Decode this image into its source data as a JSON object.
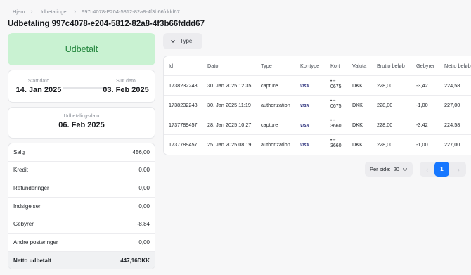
{
  "breadcrumb": {
    "items": [
      "Hjem",
      "Udbetalinger",
      "997c4078-E204-5812-82a8-4f3b66fddd67"
    ]
  },
  "page_title": "Udbetaling 997c4078-e204-5812-82a8-4f3b66fddd67",
  "status": {
    "label": "Udbetalt",
    "color": "#24873e",
    "background": "#c9f2d2"
  },
  "dates": {
    "start_label": "Start dato",
    "start_value": "14. Jan 2025",
    "end_label": "Slut dato",
    "end_value": "03. Feb 2025"
  },
  "payout_date": {
    "label": "Udbetalingsdato",
    "value": "06. Feb 2025"
  },
  "summary": [
    {
      "label": "Salg",
      "value": "456,00"
    },
    {
      "label": "Kredit",
      "value": "0,00"
    },
    {
      "label": "Refunderinger",
      "value": "0,00"
    },
    {
      "label": "Indsigelser",
      "value": "0,00"
    },
    {
      "label": "Gebyrer",
      "value": "-8,84"
    },
    {
      "label": "Andre posteringer",
      "value": "0,00"
    },
    {
      "label": "Netto udbetalt",
      "value": "447,16DKK"
    }
  ],
  "filter": {
    "type_label": "Type"
  },
  "table": {
    "columns": [
      "Id",
      "Dato",
      "Type",
      "Korttype",
      "Kort",
      "Valuta",
      "Brutto beløb",
      "Gebyrer",
      "Netto beløb"
    ],
    "rows": [
      {
        "id": "1738232248",
        "date": "30. Jan 2025 12:35",
        "type": "capture",
        "card_type": "VISA",
        "card_dots": "•••",
        "card_last4": "0675",
        "currency": "DKK",
        "gross": "228,00",
        "fees": "-3,42",
        "net": "224,58"
      },
      {
        "id": "1738232248",
        "date": "30. Jan 2025 11:19",
        "type": "authorization",
        "card_type": "VISA",
        "card_dots": "•••",
        "card_last4": "0675",
        "currency": "DKK",
        "gross": "228,00",
        "fees": "-1,00",
        "net": "227,00"
      },
      {
        "id": "1737789457",
        "date": "28. Jan 2025 10:27",
        "type": "capture",
        "card_type": "VISA",
        "card_dots": "•••",
        "card_last4": "3660",
        "currency": "DKK",
        "gross": "228,00",
        "fees": "-3,42",
        "net": "224,58"
      },
      {
        "id": "1737789457",
        "date": "25. Jan 2025 08:19",
        "type": "authorization",
        "card_type": "VISA",
        "card_dots": "•••",
        "card_last4": "3660",
        "currency": "DKK",
        "gross": "228,00",
        "fees": "-1,00",
        "net": "227,00"
      }
    ]
  },
  "pagination": {
    "per_page_label": "Per side:",
    "per_page_value": "20",
    "current_page": "1",
    "prev_icon": "‹",
    "next_icon": "›"
  },
  "colors": {
    "accent": "#1677ff"
  }
}
